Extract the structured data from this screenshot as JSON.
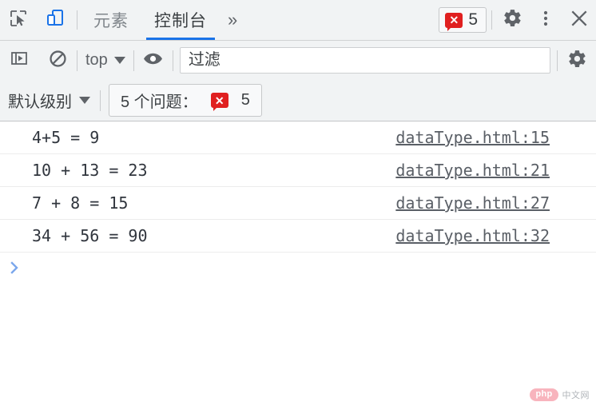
{
  "window": {
    "app": "Chrome DevTools",
    "panel": "Console"
  },
  "tabbar": {
    "inspect_icon": "inspect-element-icon",
    "device_icon": "device-toolbar-icon",
    "tabs": [
      {
        "label": "元素",
        "active": false
      },
      {
        "label": "控制台",
        "active": true
      }
    ],
    "more_tabs": "»",
    "error_badge": {
      "icon_glyph": "✕",
      "count": "5"
    },
    "settings_icon": "gear-icon",
    "more_icon": "kebab-menu-icon",
    "close_icon": "close-icon",
    "active_tab_underline_color": "#1a73e8",
    "background": "#f1f3f4"
  },
  "console_toolbar": {
    "sidebar_toggle_icon": "console-sidebar-icon",
    "clear_icon": "clear-console-icon",
    "context_selector": {
      "value": "top",
      "caret": "▼"
    },
    "eye_icon": "live-expression-eye-icon",
    "filter": {
      "value": "",
      "placeholder": "过滤"
    },
    "settings_icon": "console-settings-gear-icon"
  },
  "level_bar": {
    "level_selector": {
      "label": "默认级别",
      "caret": "▼"
    },
    "issues_chip": {
      "label": "5 个问题：",
      "error_glyph": "✕",
      "count": "5"
    }
  },
  "messages": [
    {
      "text": "4+5 = 9",
      "source": "dataType.html:15"
    },
    {
      "text": "10 + 13 = 23",
      "source": "dataType.html:21"
    },
    {
      "text": "7 + 8 = 15",
      "source": "dataType.html:27"
    },
    {
      "text": "34 + 56 = 90",
      "source": "dataType.html:32"
    }
  ],
  "prompt": {
    "caret": "›",
    "value": "",
    "placeholder": ""
  },
  "watermark": {
    "badge": "php",
    "text": "中文网"
  },
  "colors": {
    "toolbar_bg": "#f1f3f4",
    "console_bg": "#ffffff",
    "accent_blue": "#1a73e8",
    "error_red": "#e02020",
    "message_text": "#30353d",
    "link_text": "#5a5f66",
    "prompt_caret": "#7ba7ec"
  }
}
